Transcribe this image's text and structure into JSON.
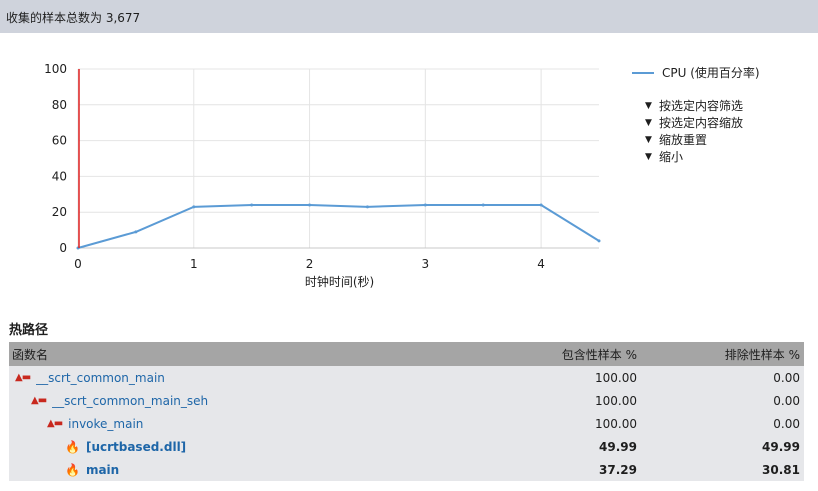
{
  "header": {
    "text": "收集的样本总数为 3,677"
  },
  "chart_data": {
    "type": "line",
    "xlabel": "时钟时间(秒)",
    "ylabel": "",
    "xlim": [
      0,
      4.5
    ],
    "ylim": [
      0,
      100
    ],
    "x_ticks": [
      "0",
      "1",
      "2",
      "3",
      "4"
    ],
    "y_ticks": [
      "0",
      "20",
      "40",
      "60",
      "80",
      "100"
    ],
    "grid": true,
    "legend_position": "right",
    "series": [
      {
        "name": "CPU (使用百分率)",
        "color": "#5b9bd5",
        "x": [
          0,
          0.5,
          1,
          1.5,
          2,
          2.5,
          3,
          3.5,
          4,
          4.5
        ],
        "values": [
          0,
          9,
          23,
          24,
          24,
          23,
          24,
          24,
          24,
          4
        ]
      }
    ],
    "marker_line": {
      "x": 0,
      "color": "#e02020"
    }
  },
  "legend": {
    "cpu_label": "CPU (使用百分率)"
  },
  "filters": [
    {
      "label": "按选定内容筛选",
      "icon": "filter-pin-icon"
    },
    {
      "label": "按选定内容缩放",
      "icon": "filter-icon"
    },
    {
      "label": "缩放重置",
      "icon": "filter-icon"
    },
    {
      "label": "缩小",
      "icon": "filter-icon"
    }
  ],
  "hot_path": {
    "title": "热路径",
    "columns": {
      "name": "函数名",
      "inclusive": "包含性样本 %",
      "exclusive": "排除性样本 %"
    },
    "rows": [
      {
        "name": "__scrt_common_main",
        "inclusive": "100.00",
        "exclusive": "0.00",
        "icon": "hot-path-icon"
      },
      {
        "name": "__scrt_common_main_seh",
        "inclusive": "100.00",
        "exclusive": "0.00",
        "icon": "hot-path-icon"
      },
      {
        "name": "invoke_main",
        "inclusive": "100.00",
        "exclusive": "0.00",
        "icon": "hot-path-icon"
      },
      {
        "name": "[ucrtbased.dll]",
        "inclusive": "49.99",
        "exclusive": "49.99",
        "icon": "flame-icon"
      },
      {
        "name": "main",
        "inclusive": "37.29",
        "exclusive": "30.81",
        "icon": "flame-icon"
      }
    ]
  }
}
